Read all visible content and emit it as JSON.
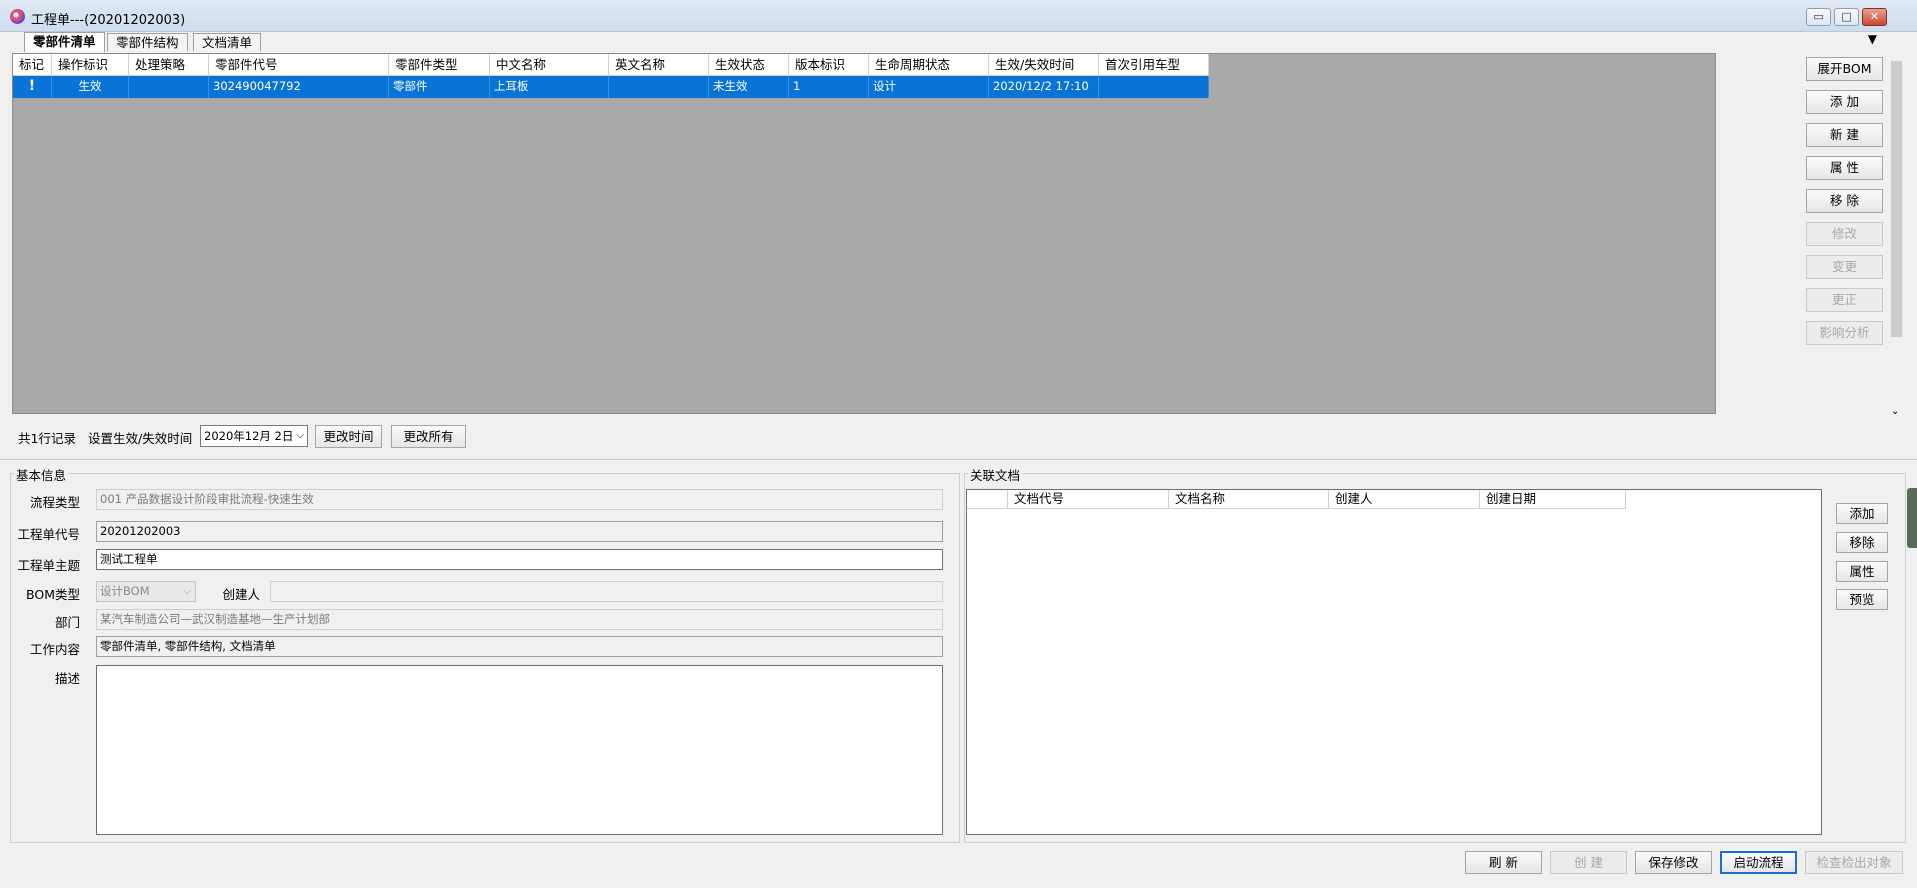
{
  "window": {
    "title": "工程单---(20201202003)",
    "minimize": "▭",
    "maximize": "□",
    "close": "✕",
    "overflow_arrow": "▼"
  },
  "tabs": [
    {
      "label": "零部件清单",
      "active": true
    },
    {
      "label": "零部件结构",
      "active": false
    },
    {
      "label": "文档清单",
      "active": false
    }
  ],
  "parts_grid": {
    "columns": [
      "标记",
      "操作标识",
      "处理策略",
      "零部件代号",
      "零部件类型",
      "中文名称",
      "英文名称",
      "生效状态",
      "版本标识",
      "生命周期状态",
      "生效/失效时间",
      "首次引用车型"
    ],
    "rows": [
      [
        "!",
        "生效",
        "",
        "302490047792",
        "零部件",
        "上耳板",
        "",
        "未生效",
        "1",
        "设计",
        "2020/12/2 17:10",
        ""
      ]
    ],
    "selected_row_color": "#0a74d6"
  },
  "side_buttons": [
    {
      "label": "展开BOM",
      "enabled": true
    },
    {
      "label": "添 加",
      "enabled": true
    },
    {
      "label": "新 建",
      "enabled": true
    },
    {
      "label": "属 性",
      "enabled": true
    },
    {
      "label": "移 除",
      "enabled": true
    },
    {
      "label": "修改",
      "enabled": false
    },
    {
      "label": "变更",
      "enabled": false
    },
    {
      "label": "更正",
      "enabled": false
    },
    {
      "label": "影响分析",
      "enabled": false
    }
  ],
  "grid_footer": {
    "record_count": "共1行记录",
    "set_time_label": "设置生效/失效时间",
    "date_value": "2020年12月  2日",
    "change_time_button": "更改时间",
    "change_all_button": "更改所有"
  },
  "basic_info": {
    "group_title": "基本信息",
    "process_type_label": "流程类型",
    "process_type_value": "001  产品数据设计阶段审批流程-快速生效",
    "order_code_label": "工程单代号",
    "order_code_value": "20201202003",
    "subject_label": "工程单主题",
    "subject_value": "测试工程单",
    "bom_type_label": "BOM类型",
    "bom_type_value": "设计BOM",
    "creator_label": "创建人",
    "creator_value": "",
    "dept_label": "部门",
    "dept_value": "某汽车制造公司—武汉制造基地—生产计划部",
    "work_content_label": "工作内容",
    "work_content_value": "零部件清单, 零部件结构, 文档清单",
    "desc_label": "描述",
    "desc_value": ""
  },
  "related_docs": {
    "group_title": "关联文档",
    "columns": [
      "",
      "文档代号",
      "文档名称",
      "创建人",
      "创建日期"
    ],
    "buttons": [
      "添加",
      "移除",
      "属性",
      "预览"
    ]
  },
  "bottom_buttons": [
    {
      "label": "刷 新",
      "enabled": true,
      "focused": false
    },
    {
      "label": "创 建",
      "enabled": false,
      "focused": false
    },
    {
      "label": "保存修改",
      "enabled": true,
      "focused": false
    },
    {
      "label": "启动流程",
      "enabled": true,
      "focused": true
    },
    {
      "label": "检查检出对象",
      "enabled": false,
      "focused": false
    }
  ]
}
